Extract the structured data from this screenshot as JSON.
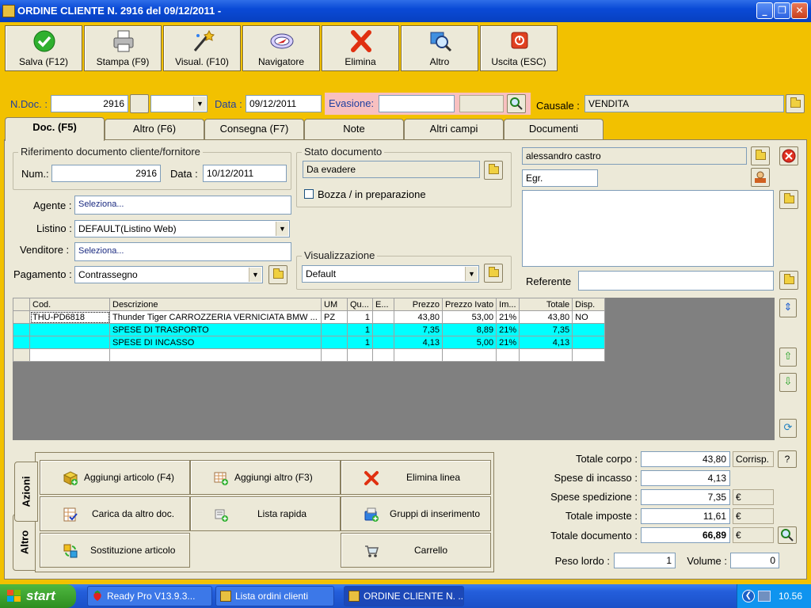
{
  "window": {
    "title": "ORDINE CLIENTE N.  2916  del 09/12/2011  -"
  },
  "toolbar": {
    "buttons": [
      {
        "label": "Salva (F12)",
        "icon": "check-icon"
      },
      {
        "label": "Stampa (F9)",
        "icon": "printer-icon"
      },
      {
        "label": "Visual. (F10)",
        "icon": "magic-wand-icon"
      },
      {
        "label": "Navigatore",
        "icon": "compass-icon"
      },
      {
        "label": "Elimina",
        "icon": "delete-x-icon"
      },
      {
        "label": "Altro",
        "icon": "magnifier-icon"
      },
      {
        "label": "Uscita (ESC)",
        "icon": "exit-icon"
      }
    ]
  },
  "header": {
    "ndoc_label": "N.Doc. :",
    "ndoc_value": "2916",
    "data_label": "Data :",
    "data_value": "09/12/2011",
    "evasione_label": "Evasione:",
    "evasione_value": "",
    "causale_label": "Causale :",
    "causale_value": "VENDITA"
  },
  "tabs": [
    "Doc. (F5)",
    "Altro (F6)",
    "Consegna (F7)",
    "Note",
    "Altri campi",
    "Documenti"
  ],
  "riferimento": {
    "title": "Riferimento documento cliente/fornitore",
    "num_label": "Num.:",
    "num_value": "2916",
    "data_label": "Data :",
    "data_value": "10/12/2011"
  },
  "stato": {
    "title": "Stato documento",
    "value": "Da evadere",
    "bozza_label": "Bozza / in preparazione",
    "bozza_checked": false
  },
  "fields": {
    "agente_label": "Agente :",
    "agente_value": "Seleziona...",
    "listino_label": "Listino :",
    "listino_value": "DEFAULT(Listino Web)",
    "venditore_label": "Venditore :",
    "venditore_value": "Seleziona...",
    "pagamento_label": "Pagamento :",
    "pagamento_value": "Contrassegno"
  },
  "visualizzazione": {
    "title": "Visualizzazione",
    "value": "Default"
  },
  "cliente": {
    "name": "alessandro castro",
    "salutation": "Egr.",
    "address": "",
    "referente_label": "Referente",
    "referente_value": ""
  },
  "grid": {
    "columns": [
      "Cod.",
      "Descrizione",
      "UM",
      "Qu...",
      "E...",
      "Prezzo",
      "Prezzo Ivato",
      "Im...",
      "Totale",
      "Disp."
    ],
    "rows": [
      {
        "cod": "THU-PD6818",
        "descr": "Thunder Tiger CARROZZERIA VERNICIATA BMW ...",
        "um": "PZ",
        "qty": "1",
        "e": "",
        "prezzo": "43,80",
        "ivato": "53,00",
        "iva": "21%",
        "totale": "43,80",
        "disp": "NO",
        "style": "w"
      },
      {
        "cod": "",
        "descr": "SPESE DI TRASPORTO",
        "um": "",
        "qty": "1",
        "e": "",
        "prezzo": "7,35",
        "ivato": "8,89",
        "iva": "21%",
        "totale": "7,35",
        "disp": "",
        "style": "c"
      },
      {
        "cod": "",
        "descr": "SPESE DI INCASSO",
        "um": "",
        "qty": "1",
        "e": "",
        "prezzo": "4,13",
        "ivato": "5,00",
        "iva": "21%",
        "totale": "4,13",
        "disp": "",
        "style": "c"
      },
      {
        "cod": "",
        "descr": "",
        "um": "",
        "qty": "",
        "e": "",
        "prezzo": "",
        "ivato": "",
        "iva": "",
        "totale": "",
        "disp": "",
        "style": "w"
      }
    ]
  },
  "actions": {
    "vtabs": [
      "Azioni",
      "Altro"
    ],
    "buttons": [
      {
        "label": "Aggiungi articolo (F4)",
        "icon": "add-article-icon"
      },
      {
        "label": "Aggiungi altro (F3)",
        "icon": "add-grid-icon"
      },
      {
        "label": "Elimina linea",
        "icon": "delete-x-icon"
      },
      {
        "label": "Carica da altro doc.",
        "icon": "load-doc-icon"
      },
      {
        "label": "Lista rapida",
        "icon": "quick-list-icon"
      },
      {
        "label": "Gruppi di inserimento",
        "icon": "group-insert-icon"
      },
      {
        "label": "Sostituzione articolo",
        "icon": "replace-article-icon"
      },
      {
        "label": "Carrello",
        "icon": "cart-icon"
      }
    ]
  },
  "totals": {
    "corpo_label": "Totale corpo :",
    "corpo_value": "43,80",
    "corrisp_label": "Corrisp.",
    "help_label": "?",
    "incasso_label": "Spese di incasso :",
    "incasso_value": "4,13",
    "spedizione_label": "Spese spedizione :",
    "spedizione_value": "7,35",
    "imposte_label": "Totale imposte :",
    "imposte_value": "11,61",
    "documento_label": "Totale documento :",
    "documento_value": "66,89",
    "currency": "€",
    "peso_label": "Peso lordo :",
    "peso_value": "1",
    "volume_label": "Volume :",
    "volume_value": "0"
  },
  "taskbar": {
    "start_label": "start",
    "items": [
      "Ready Pro V13.9.3...",
      "Lista ordini clienti",
      "ORDINE CLIENTE N. ..."
    ],
    "clock": "10.56"
  }
}
